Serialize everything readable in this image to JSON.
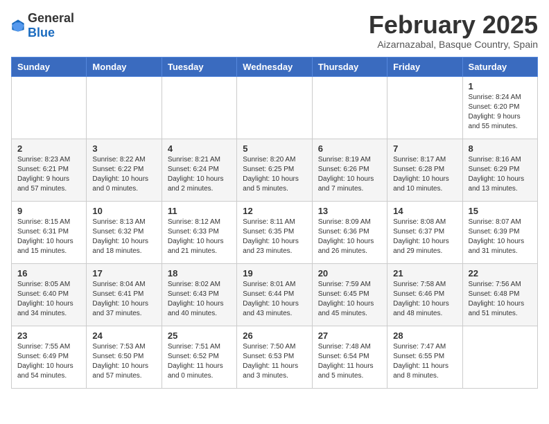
{
  "logo": {
    "general": "General",
    "blue": "Blue"
  },
  "header": {
    "title": "February 2025",
    "subtitle": "Aizarnazabal, Basque Country, Spain"
  },
  "weekdays": [
    "Sunday",
    "Monday",
    "Tuesday",
    "Wednesday",
    "Thursday",
    "Friday",
    "Saturday"
  ],
  "weeks": [
    [
      {
        "day": "",
        "info": ""
      },
      {
        "day": "",
        "info": ""
      },
      {
        "day": "",
        "info": ""
      },
      {
        "day": "",
        "info": ""
      },
      {
        "day": "",
        "info": ""
      },
      {
        "day": "",
        "info": ""
      },
      {
        "day": "1",
        "info": "Sunrise: 8:24 AM\nSunset: 6:20 PM\nDaylight: 9 hours and 55 minutes."
      }
    ],
    [
      {
        "day": "2",
        "info": "Sunrise: 8:23 AM\nSunset: 6:21 PM\nDaylight: 9 hours and 57 minutes."
      },
      {
        "day": "3",
        "info": "Sunrise: 8:22 AM\nSunset: 6:22 PM\nDaylight: 10 hours and 0 minutes."
      },
      {
        "day": "4",
        "info": "Sunrise: 8:21 AM\nSunset: 6:24 PM\nDaylight: 10 hours and 2 minutes."
      },
      {
        "day": "5",
        "info": "Sunrise: 8:20 AM\nSunset: 6:25 PM\nDaylight: 10 hours and 5 minutes."
      },
      {
        "day": "6",
        "info": "Sunrise: 8:19 AM\nSunset: 6:26 PM\nDaylight: 10 hours and 7 minutes."
      },
      {
        "day": "7",
        "info": "Sunrise: 8:17 AM\nSunset: 6:28 PM\nDaylight: 10 hours and 10 minutes."
      },
      {
        "day": "8",
        "info": "Sunrise: 8:16 AM\nSunset: 6:29 PM\nDaylight: 10 hours and 13 minutes."
      }
    ],
    [
      {
        "day": "9",
        "info": "Sunrise: 8:15 AM\nSunset: 6:31 PM\nDaylight: 10 hours and 15 minutes."
      },
      {
        "day": "10",
        "info": "Sunrise: 8:13 AM\nSunset: 6:32 PM\nDaylight: 10 hours and 18 minutes."
      },
      {
        "day": "11",
        "info": "Sunrise: 8:12 AM\nSunset: 6:33 PM\nDaylight: 10 hours and 21 minutes."
      },
      {
        "day": "12",
        "info": "Sunrise: 8:11 AM\nSunset: 6:35 PM\nDaylight: 10 hours and 23 minutes."
      },
      {
        "day": "13",
        "info": "Sunrise: 8:09 AM\nSunset: 6:36 PM\nDaylight: 10 hours and 26 minutes."
      },
      {
        "day": "14",
        "info": "Sunrise: 8:08 AM\nSunset: 6:37 PM\nDaylight: 10 hours and 29 minutes."
      },
      {
        "day": "15",
        "info": "Sunrise: 8:07 AM\nSunset: 6:39 PM\nDaylight: 10 hours and 31 minutes."
      }
    ],
    [
      {
        "day": "16",
        "info": "Sunrise: 8:05 AM\nSunset: 6:40 PM\nDaylight: 10 hours and 34 minutes."
      },
      {
        "day": "17",
        "info": "Sunrise: 8:04 AM\nSunset: 6:41 PM\nDaylight: 10 hours and 37 minutes."
      },
      {
        "day": "18",
        "info": "Sunrise: 8:02 AM\nSunset: 6:43 PM\nDaylight: 10 hours and 40 minutes."
      },
      {
        "day": "19",
        "info": "Sunrise: 8:01 AM\nSunset: 6:44 PM\nDaylight: 10 hours and 43 minutes."
      },
      {
        "day": "20",
        "info": "Sunrise: 7:59 AM\nSunset: 6:45 PM\nDaylight: 10 hours and 45 minutes."
      },
      {
        "day": "21",
        "info": "Sunrise: 7:58 AM\nSunset: 6:46 PM\nDaylight: 10 hours and 48 minutes."
      },
      {
        "day": "22",
        "info": "Sunrise: 7:56 AM\nSunset: 6:48 PM\nDaylight: 10 hours and 51 minutes."
      }
    ],
    [
      {
        "day": "23",
        "info": "Sunrise: 7:55 AM\nSunset: 6:49 PM\nDaylight: 10 hours and 54 minutes."
      },
      {
        "day": "24",
        "info": "Sunrise: 7:53 AM\nSunset: 6:50 PM\nDaylight: 10 hours and 57 minutes."
      },
      {
        "day": "25",
        "info": "Sunrise: 7:51 AM\nSunset: 6:52 PM\nDaylight: 11 hours and 0 minutes."
      },
      {
        "day": "26",
        "info": "Sunrise: 7:50 AM\nSunset: 6:53 PM\nDaylight: 11 hours and 3 minutes."
      },
      {
        "day": "27",
        "info": "Sunrise: 7:48 AM\nSunset: 6:54 PM\nDaylight: 11 hours and 5 minutes."
      },
      {
        "day": "28",
        "info": "Sunrise: 7:47 AM\nSunset: 6:55 PM\nDaylight: 11 hours and 8 minutes."
      },
      {
        "day": "",
        "info": ""
      }
    ]
  ]
}
